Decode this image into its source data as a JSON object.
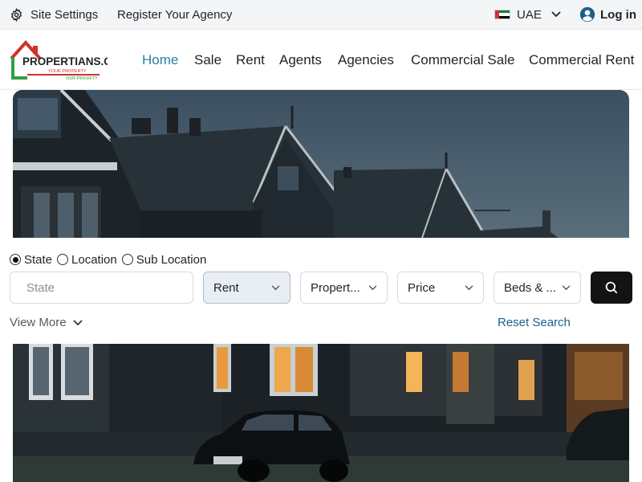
{
  "topbar": {
    "settings_label": "Site Settings",
    "register_label": "Register Your Agency",
    "language_label": "UAE",
    "login_label": "Log in"
  },
  "logo": {
    "wordmark": "PROPERTIANS.COM",
    "tagline_1": "YOUR PROPERTY",
    "tagline_2": "OUR PRIORITY"
  },
  "nav": {
    "items": [
      {
        "label": "Home",
        "active": true
      },
      {
        "label": "Sale"
      },
      {
        "label": "Rent"
      },
      {
        "label": "Agents"
      },
      {
        "label": "Agencies"
      },
      {
        "label": "Commercial Sale"
      },
      {
        "label": "Commercial Rent"
      }
    ]
  },
  "search": {
    "radios": [
      {
        "label": "State",
        "checked": true
      },
      {
        "label": "Location",
        "checked": false
      },
      {
        "label": "Sub Location",
        "checked": false
      }
    ],
    "state_placeholder": "State",
    "rent_value": "Rent",
    "property_value": "Propert...",
    "price_value": "Price",
    "beds_value": "Beds & ...",
    "view_more_label": "View More",
    "reset_label": "Reset Search"
  },
  "colors": {
    "accent": "#2d7fa8",
    "link": "#1f5f8b",
    "search_button": "#131313"
  },
  "icons": [
    "gear-icon",
    "uae-flag-icon",
    "chevron-down-icon",
    "user-circle-icon",
    "search-icon",
    "house-logo-icon"
  ]
}
